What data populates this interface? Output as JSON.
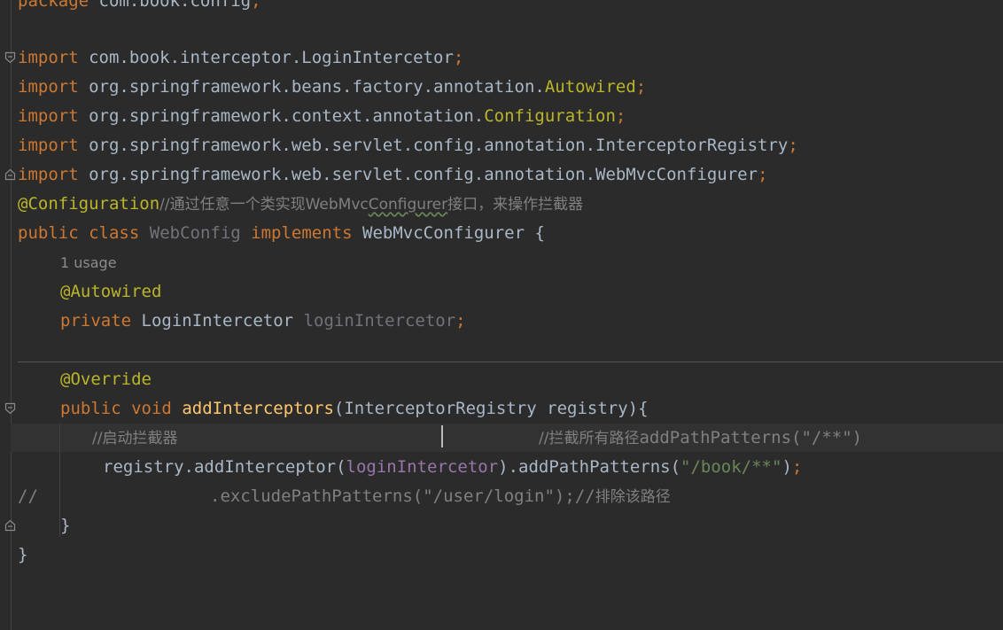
{
  "code": {
    "package_line": {
      "kw": "package",
      "name": " com.book.config",
      "semi": ";"
    },
    "imports": [
      {
        "kw": "import",
        "path": " com.book.interceptor.LoginIntercetor",
        "cls": "",
        "semi": ";"
      },
      {
        "kw": "import",
        "path": " org.springframework.beans.factory.annotation.",
        "cls": "Autowired",
        "semi": ";"
      },
      {
        "kw": "import",
        "path": " org.springframework.context.annotation.",
        "cls": "Configuration",
        "semi": ";"
      },
      {
        "kw": "import",
        "path": " org.springframework.web.servlet.config.annotation.InterceptorRegistry",
        "cls": "",
        "semi": ";"
      },
      {
        "kw": "import",
        "path": " org.springframework.web.servlet.config.annotation.WebMvcConfigurer",
        "cls": "",
        "semi": ";"
      }
    ],
    "class_annotation": "@Configuration",
    "class_comment_prefix": "//通过任意一个类实现WebMvc",
    "class_comment_underlined": "Configurer",
    "class_comment_suffix": "接口，来操作拦截器",
    "class_decl": {
      "public": "public",
      "class": "class",
      "name": "WebConfig",
      "implements": "implements",
      "iface": "WebMvcConfigurer",
      "brace": "{"
    },
    "usage_hint": "1 usage",
    "field_annotation": "@Autowired",
    "field_decl": {
      "private": "private",
      "type": "LoginIntercetor",
      "name": "loginIntercetor",
      "semi": ";"
    },
    "override_annotation": "@Override",
    "method_decl": {
      "public": "public",
      "void": "void",
      "name": "addInterceptors",
      "params": "(InterceptorRegistry registry){"
    },
    "comment_start": "//启动拦截器",
    "comment_paths_prefix": "//拦截所有路径",
    "comment_paths_code": "addPathPatterns(\"/**\")",
    "registry_call": {
      "obj": "registry.addInterceptor(",
      "arg": "loginIntercetor",
      "mid": ").addPathPatterns(",
      "str": "\"/book/**\"",
      "end": ")",
      "semi": ";"
    },
    "commented_line": {
      "slashes": "//",
      "code": ".excludePathPatterns(\"/user/login\");",
      "trail": "//",
      "trail_zh": "排除该路径"
    },
    "method_close": "}",
    "class_close": "}"
  },
  "colors": {
    "background": "#2b2b2b",
    "keyword": "#cc7832",
    "annotation": "#bbb529",
    "comment": "#808080",
    "string": "#6a8759",
    "method": "#ffc66d",
    "field": "#9876aa",
    "identifier": "#a9b7c6"
  }
}
